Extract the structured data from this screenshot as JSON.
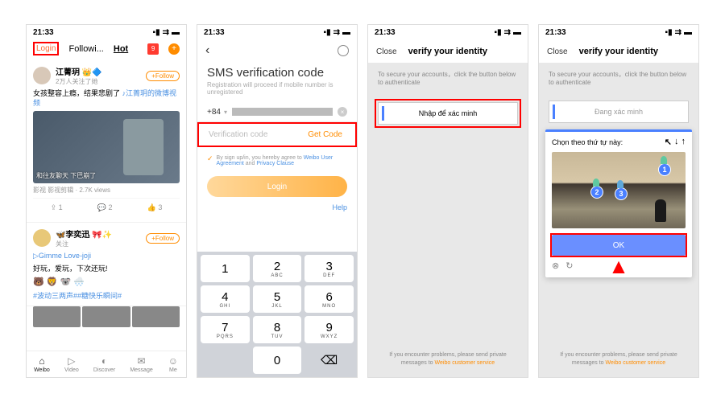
{
  "status": {
    "time": "21:33",
    "sig": "▪▮",
    "wifi": "⇉",
    "batt": "▬"
  },
  "p1": {
    "tabs": {
      "login": "Login",
      "following": "Followi...",
      "hot": "Hot",
      "badge": "9"
    },
    "post1": {
      "user": "江菁玥 👑🔷",
      "sub": "2万人关注了她",
      "follow": "+Follow",
      "text": "女孩整容上瘾，结果悲剧了 ",
      "link": "♪江菁玥的微博视频",
      "caption": "和往友聊天 下巴崩了",
      "meta": "影视 影视剪辑 · 2.7K views",
      "a1": "1",
      "a2": "2",
      "a3": "3"
    },
    "post2": {
      "user": "🦋李奕迅 🎀✨",
      "sub": "关注",
      "follow": "+Follow",
      "link": "▷Gimme Love-joji",
      "text": "好玩，爱玩，下次还玩!",
      "emoji": "🐻 🦁 🐨 🌨️",
      "tag": "#波动三两声##糖快乐瞬间#"
    },
    "bar": {
      "weibo": "Weibo",
      "video": "Video",
      "discover": "Discover",
      "message": "Message",
      "me": "Me"
    }
  },
  "p2": {
    "title": "SMS verification code",
    "sub": "Registration will proceed if mobile number is unregistered",
    "prefix": "+84",
    "vc_ph": "Verification code",
    "getcode": "Get Code",
    "agree_pre": "By sign up/in, you hereby agree to ",
    "ua": "Weibo User Agreement",
    "and": " and ",
    "pc": "Privacy Clause",
    "login": "Login",
    "help": "Help",
    "keys": [
      [
        "1",
        ""
      ],
      [
        "2",
        "ABC"
      ],
      [
        "3",
        "DEF"
      ],
      [
        "4",
        "GHI"
      ],
      [
        "5",
        "JKL"
      ],
      [
        "6",
        "MNO"
      ],
      [
        "7",
        "PQRS"
      ],
      [
        "8",
        "TUV"
      ],
      [
        "9",
        "WXYZ"
      ],
      [
        "",
        ""
      ],
      [
        "0",
        ""
      ],
      [
        "⌫",
        ""
      ]
    ]
  },
  "p3": {
    "close": "Close",
    "title": "verify your identity",
    "info": "To secure your accounts，click the button below to authenticate",
    "btn": "Nhập để xác minh",
    "foot_pre": "If you encounter problems, please send private messages to ",
    "foot_link": "Weibo customer service"
  },
  "p4": {
    "close": "Close",
    "title": "verify your identity",
    "info": "To secure your accounts，click the button below to authenticate",
    "btn": "Đang xác minh",
    "cap_title": "Chọn theo thứ tự này:",
    "ar1": "↖",
    "ar2": "↓",
    "ar3": "↑",
    "d1": "1",
    "d2": "2",
    "d3": "3",
    "ok": "OK",
    "foot_pre": "If you encounter problems, please send private messages to ",
    "foot_link": "Weibo customer service"
  }
}
